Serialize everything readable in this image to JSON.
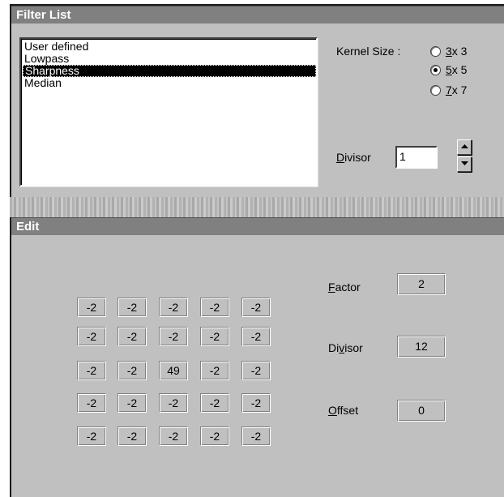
{
  "filter_list": {
    "title": "Filter List",
    "items": [
      "User defined",
      "Lowpass",
      "Sharpness",
      "Median"
    ],
    "selected_index": 2,
    "kernel_size_label": "Kernel Size :",
    "kernel_options": [
      {
        "label": "3 x 3",
        "accel": "3",
        "rest": " x 3",
        "checked": false
      },
      {
        "label": "5 x 5",
        "accel": "5",
        "rest": " x 5",
        "checked": true
      },
      {
        "label": "7 x 7",
        "accel": "7",
        "rest": " x 7",
        "checked": false
      }
    ],
    "divisor": {
      "accel": "D",
      "rest": "ivisor",
      "value": "1"
    }
  },
  "edit": {
    "title": "Edit",
    "matrix": [
      [
        "-2",
        "-2",
        "-2",
        "-2",
        "-2"
      ],
      [
        "-2",
        "-2",
        "-2",
        "-2",
        "-2"
      ],
      [
        "-2",
        "-2",
        "49",
        "-2",
        "-2"
      ],
      [
        "-2",
        "-2",
        "-2",
        "-2",
        "-2"
      ],
      [
        "-2",
        "-2",
        "-2",
        "-2",
        "-2"
      ]
    ],
    "factor": {
      "accel": "F",
      "rest": "actor",
      "value": "2"
    },
    "divisor": {
      "pre": "Di",
      "accel": "v",
      "rest": "isor",
      "value": "12"
    },
    "offset": {
      "accel": "O",
      "rest": "ffset",
      "value": "0"
    }
  }
}
